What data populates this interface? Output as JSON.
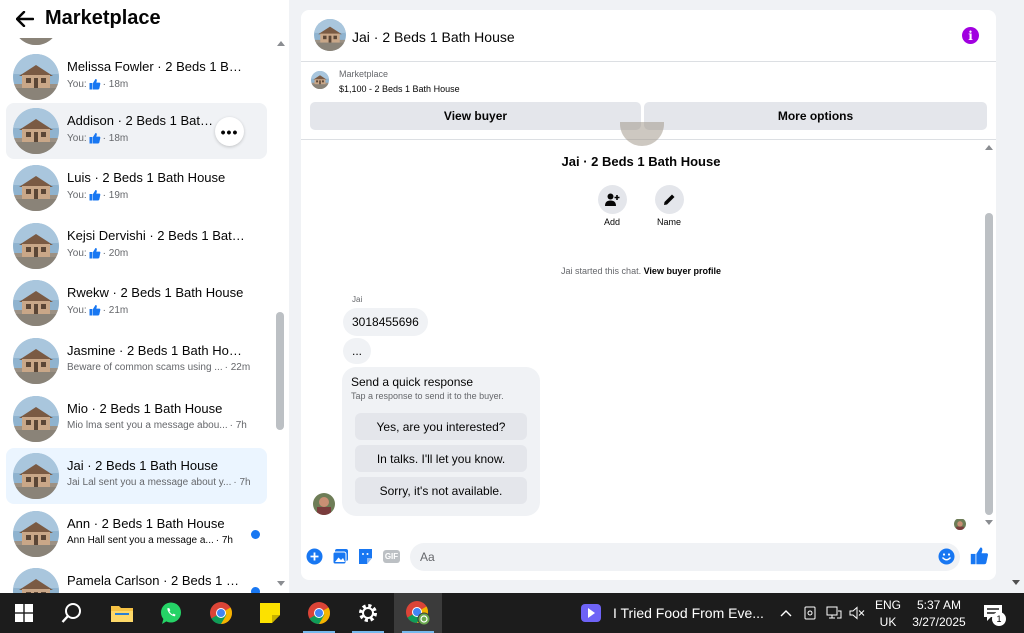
{
  "sidebar": {
    "title": "Marketplace",
    "conversations": [
      {
        "name": "Melissa Fowler · 2 Beds 1 Bath ...",
        "preview": "You:",
        "time": "· 18m",
        "liked": true
      },
      {
        "name": "Addison · 2 Beds 1 Bath House",
        "preview": "You:",
        "time": "· 18m",
        "liked": true,
        "more_label": "•••"
      },
      {
        "name": "Luis · 2 Beds 1 Bath House",
        "preview": "You:",
        "time": "· 19m",
        "liked": true
      },
      {
        "name": "Kejsi Dervishi · 2 Beds 1 Bath H...",
        "preview": "You:",
        "time": "· 20m",
        "liked": true
      },
      {
        "name": "Rwekw · 2 Beds 1 Bath House",
        "preview": "You:",
        "time": "· 21m",
        "liked": true
      },
      {
        "name": "Jasmine · 2 Beds 1 Bath House",
        "preview": "Beware of common scams using ...",
        "time": "· 22m"
      },
      {
        "name": "Mio · 2 Beds 1 Bath House",
        "preview": "Mio lma sent you a message abou...",
        "time": "· 7h"
      },
      {
        "name": "Jai · 2 Beds 1 Bath House",
        "preview": "Jai Lal sent you a message about y...",
        "time": "· 7h"
      },
      {
        "name": "Ann · 2 Beds 1 Bath House",
        "preview": "Ann Hall sent you a message a...",
        "time": "· 7h",
        "unread": true
      },
      {
        "name": "Pamela Carlson · 2 Beds 1 Bat...",
        "preview": "",
        "time": "",
        "unread": true
      }
    ]
  },
  "chat": {
    "title": "Jai · 2 Beds 1 Bath House",
    "marketplace_label": "Marketplace",
    "listing": "$1,100 - 2 Beds 1 Bath House",
    "view_buyer": "View buyer",
    "more_options": "More options",
    "profile_name": "Jai · 2 Beds 1 Bath House",
    "add_label": "Add",
    "name_label": "Name",
    "started_text": "Jai started this chat.",
    "view_buyer_profile": "View buyer profile",
    "sender": "Jai",
    "messages": [
      "3018455696",
      "..."
    ],
    "quick_response": {
      "title": "Send a quick response",
      "subtitle": "Tap a response to send it to the buyer.",
      "options": [
        "Yes, are you interested?",
        "In talks. I'll let you know.",
        "Sorry, it's not available."
      ]
    },
    "composer_placeholder": "Aa",
    "gif_label": "GIF"
  },
  "taskbar": {
    "media_title": "I Tried Food From Eve...",
    "lang_line1": "ENG",
    "lang_line2": "UK",
    "time": "5:37 AM",
    "date": "3/27/2025",
    "notification_count": "1"
  },
  "colors": {
    "accent": "#1877f2",
    "info": "#a100e0",
    "selected_bg": "#ebf5ff"
  }
}
